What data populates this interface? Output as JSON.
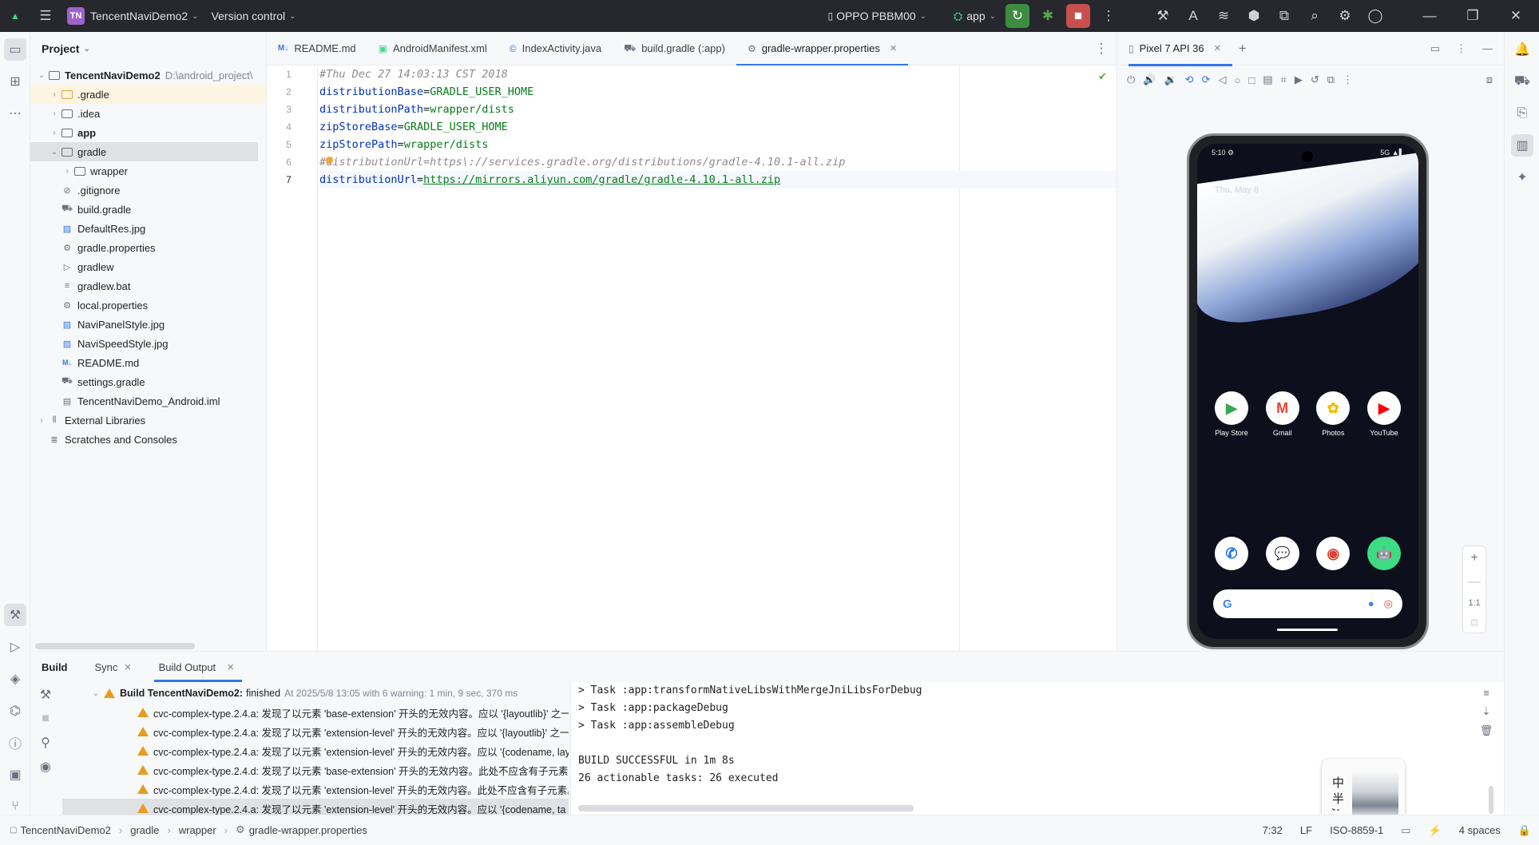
{
  "titlebar": {
    "project_badge": "TN",
    "project_name": "TencentNaviDemo2",
    "vcs": "Version control",
    "device": "OPPO PBBM00",
    "run_config": "app"
  },
  "project_panel": {
    "title": "Project",
    "root": {
      "name": "TencentNaviDemo2",
      "path": "D:\\android_project\\"
    },
    "items": [
      {
        "label": ".gradle"
      },
      {
        "label": ".idea"
      },
      {
        "label": "app"
      },
      {
        "label": "gradle"
      },
      {
        "label": "wrapper"
      },
      {
        "label": ".gitignore"
      },
      {
        "label": "build.gradle"
      },
      {
        "label": "DefaultRes.jpg"
      },
      {
        "label": "gradle.properties"
      },
      {
        "label": "gradlew"
      },
      {
        "label": "gradlew.bat"
      },
      {
        "label": "local.properties"
      },
      {
        "label": "NaviPanelStyle.jpg"
      },
      {
        "label": "NaviSpeedStyle.jpg"
      },
      {
        "label": "README.md"
      },
      {
        "label": "settings.gradle"
      },
      {
        "label": "TencentNaviDemo_Android.iml"
      },
      {
        "label": "External Libraries"
      },
      {
        "label": "Scratches and Consoles"
      }
    ]
  },
  "editor_tabs": [
    {
      "label": "README.md",
      "icon": "M↓"
    },
    {
      "label": "AndroidManifest.xml",
      "icon": "▣"
    },
    {
      "label": "IndexActivity.java",
      "icon": "©"
    },
    {
      "label": "build.gradle (:app)",
      "icon": "⛟"
    },
    {
      "label": "gradle-wrapper.properties",
      "icon": "⚙"
    }
  ],
  "editor": {
    "line_numbers": [
      "1",
      "2",
      "3",
      "4",
      "5",
      "6",
      "7"
    ],
    "lines": [
      {
        "comment": "#Thu Dec 27 14:03:13 CST 2018"
      },
      {
        "key": "distributionBase",
        "eq": "=",
        "value": "GRADLE_USER_HOME"
      },
      {
        "key": "distributionPath",
        "eq": "=",
        "value": "wrapper/dists"
      },
      {
        "key": "zipStoreBase",
        "eq": "=",
        "value": "GRADLE_USER_HOME"
      },
      {
        "key": "zipStorePath",
        "eq": "=",
        "value": "wrapper/dists"
      },
      {
        "comment": "#distributionUrl=https\\://services.gradle.org/distributions/gradle-4.10.1-all.zip"
      },
      {
        "key": "distributionUrl",
        "eq": "=",
        "value": "https://mirrors.aliyun.com/gradle/gradle-4.10.1-all.zip"
      }
    ]
  },
  "emulator": {
    "tab_label": "Pixel 7 API 36",
    "status_left": "5:10 ⚙",
    "status_right": "5G ▲▌",
    "date": "Thu, May 8",
    "apps_row1": [
      {
        "label": "Play Store",
        "glyph": "▶",
        "color": "#34a853"
      },
      {
        "label": "Gmail",
        "glyph": "M",
        "color": "#ea4335"
      },
      {
        "label": "Photos",
        "glyph": "✿",
        "color": "#fbbc05"
      },
      {
        "label": "YouTube",
        "glyph": "▶",
        "color": "#ff0000"
      }
    ],
    "apps_row2": [
      {
        "label": "",
        "glyph": "✆",
        "color": "#1a73e8"
      },
      {
        "label": "",
        "glyph": "💬",
        "color": "#1a73e8"
      },
      {
        "label": "",
        "glyph": "◉",
        "color": "#db4437"
      },
      {
        "label": "",
        "glyph": "🤖",
        "color": "#3ddc84"
      }
    ],
    "search_g": "G",
    "zoom_ratio": "1:1"
  },
  "build": {
    "tabs": [
      "Build",
      "Sync",
      "Build Output"
    ],
    "root_label": "Build TencentNaviDemo2:",
    "root_status": "finished",
    "root_meta": "At 2025/5/8 13:05 with 6 warning: 1 min, 9 sec, 370 ms",
    "warnings": [
      "cvc-complex-type.2.4.a: 发现了以元素 'base-extension' 开头的无效内容。应以 '{layoutlib}' 之一",
      "cvc-complex-type.2.4.a: 发现了以元素 'extension-level' 开头的无效内容。应以 '{layoutlib}' 之一",
      "cvc-complex-type.2.4.a: 发现了以元素 'extension-level' 开头的无效内容。应以 '{codename, lay",
      "cvc-complex-type.2.4.d: 发现了以元素 'base-extension' 开头的无效内容。此处不应含有子元素。",
      "cvc-complex-type.2.4.d: 发现了以元素 'extension-level' 开头的无效内容。此处不应含有子元素。",
      "cvc-complex-type.2.4.a: 发现了以元素 'extension-level' 开头的无效内容。应以 '{codename, ta"
    ],
    "output": [
      "> Task :app:transformNativeLibsWithMergeJniLibsForDebug",
      "> Task :app:packageDebug",
      "> Task :app:assembleDebug",
      "",
      "BUILD SUCCESSFUL in 1m 8s",
      "26 actionable tasks: 26 executed"
    ],
    "seal_text": "中 半 ;"
  },
  "statusbar": {
    "breadcrumbs": [
      "TencentNaviDemo2",
      "gradle",
      "wrapper",
      "gradle-wrapper.properties"
    ],
    "position": "7:32",
    "line_sep": "LF",
    "encoding": "ISO-8859-1",
    "indent": "4 spaces"
  }
}
